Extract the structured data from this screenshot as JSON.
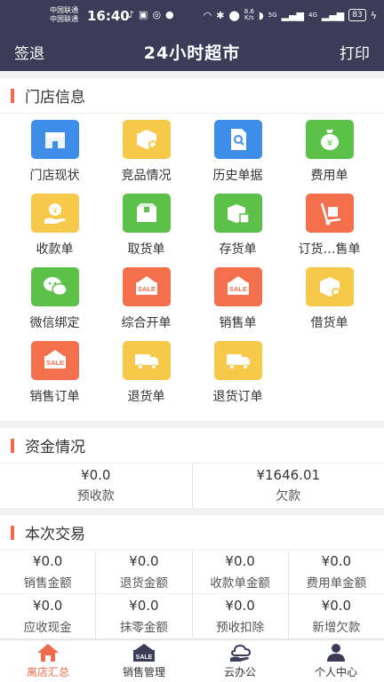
{
  "status_bar": {
    "carrier1": "中国联通",
    "carrier2": "中国联通",
    "time": "16:40",
    "net_speed_value": "8.6",
    "net_speed_unit": "K/s",
    "signal_label": "5G",
    "signal2_label": "4G",
    "battery": "83"
  },
  "header": {
    "left": "签退",
    "title": "24小时超市",
    "right": "打印"
  },
  "store_section": {
    "title": "门店信息",
    "items": [
      {
        "label": "门店现状",
        "color": "#3d8ee8",
        "icon": "storefront-icon"
      },
      {
        "label": "竞品情况",
        "color": "#f7c94a",
        "icon": "box-search-icon"
      },
      {
        "label": "历史单据",
        "color": "#3d8ee8",
        "icon": "document-search-icon"
      },
      {
        "label": "费用单",
        "color": "#5cc148",
        "icon": "money-bag-icon"
      },
      {
        "label": "收款单",
        "color": "#f7c94a",
        "icon": "coin-hand-icon"
      },
      {
        "label": "取货单",
        "color": "#5cc148",
        "icon": "box-icon"
      },
      {
        "label": "存货单",
        "color": "#5cc148",
        "icon": "box-storage-icon"
      },
      {
        "label": "订货…售单",
        "color": "#f46f4c",
        "icon": "hand-truck-icon"
      },
      {
        "label": "微信绑定",
        "color": "#5cc148",
        "icon": "wechat-icon"
      },
      {
        "label": "综合开单",
        "color": "#f46f4c",
        "icon": "sale-sign-icon"
      },
      {
        "label": "销售单",
        "color": "#f46f4c",
        "icon": "sale-sign-icon"
      },
      {
        "label": "借货单",
        "color": "#f7c94a",
        "icon": "box-search-icon"
      },
      {
        "label": "销售订单",
        "color": "#f46f4c",
        "icon": "sale-sign-icon"
      },
      {
        "label": "退货单",
        "color": "#f7c94a",
        "icon": "delivery-truck-icon"
      },
      {
        "label": "退货订单",
        "color": "#f7c94a",
        "icon": "delivery-truck-icon"
      }
    ]
  },
  "funds_section": {
    "title": "资金情况",
    "items": [
      {
        "value": "¥0.0",
        "label": "预收款"
      },
      {
        "value": "¥1646.01",
        "label": "欠款"
      }
    ]
  },
  "trade_section": {
    "title": "本次交易",
    "rows": [
      [
        {
          "value": "¥0.0",
          "label": "销售金额"
        },
        {
          "value": "¥0.0",
          "label": "退货金额"
        },
        {
          "value": "¥0.0",
          "label": "收款单金额"
        },
        {
          "value": "¥0.0",
          "label": "费用单金额"
        }
      ],
      [
        {
          "value": "¥0.0",
          "label": "应收现金"
        },
        {
          "value": "¥0.0",
          "label": "抹零金额"
        },
        {
          "value": "¥0.0",
          "label": "预收扣除"
        },
        {
          "value": "¥0.0",
          "label": "新增欠款"
        }
      ]
    ]
  },
  "bottom_nav": {
    "items": [
      {
        "label": "离店汇总",
        "icon": "home-icon",
        "active": true
      },
      {
        "label": "销售管理",
        "icon": "sale-sign-icon",
        "icon_text": "SALE"
      },
      {
        "label": "云办公",
        "icon": "cloud-hand-icon"
      },
      {
        "label": "个人中心",
        "icon": "person-icon"
      }
    ]
  },
  "colors": {
    "header_bg": "#3c3c58",
    "accent": "#f06a4b"
  }
}
